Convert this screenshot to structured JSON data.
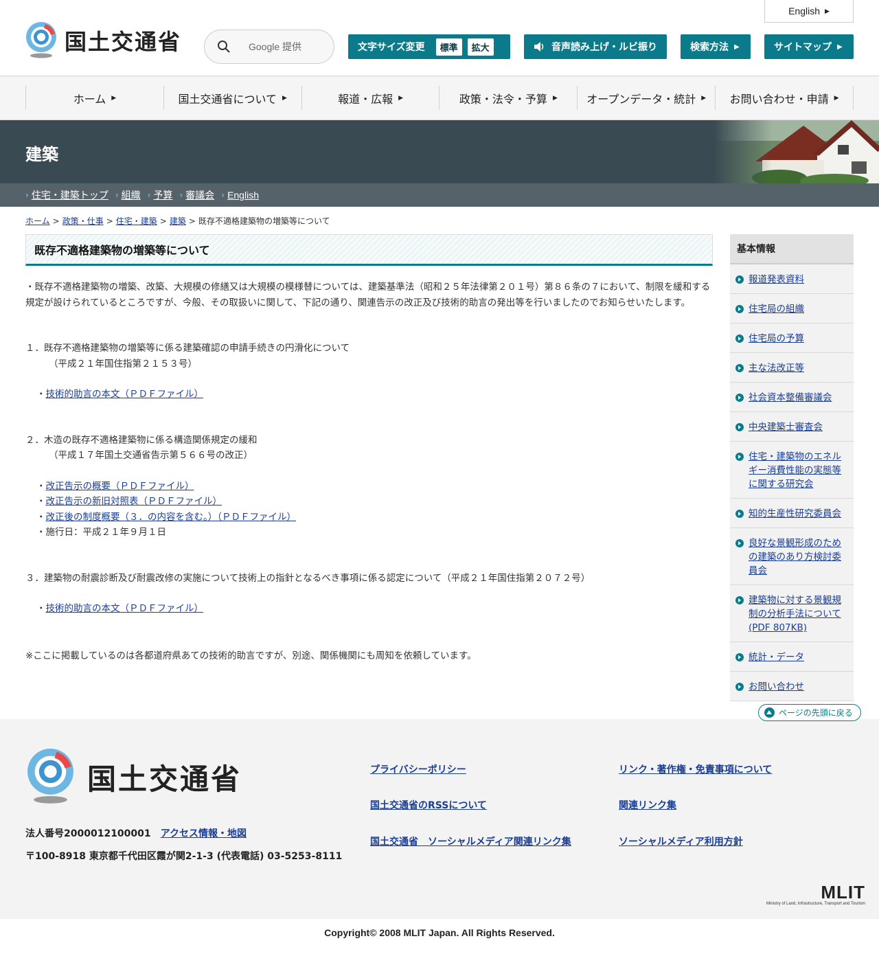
{
  "header": {
    "logo_text": "国土交通省",
    "english_label": "English",
    "search": {
      "placeholder": "Google 提供"
    },
    "fontsize": {
      "label": "文字サイズ変更",
      "standard": "標準",
      "large": "拡大"
    },
    "voice_label": "音声読み上げ・ルビ振り",
    "howsearch_label": "検索方法",
    "sitemap_label": "サイトマップ"
  },
  "gnav": [
    "ホーム",
    "国土交通省について",
    "報道・広報",
    "政策・法令・予算",
    "オープンデータ・統計",
    "お問い合わせ・申請"
  ],
  "banner": {
    "title": "建築"
  },
  "subnav": [
    "住宅・建築トップ",
    "組織",
    "予算",
    "審議会",
    "English"
  ],
  "breadcrumb": {
    "items": [
      "ホーム",
      "政策・仕事",
      "住宅・建築",
      "建築"
    ],
    "current": "既存不適格建築物の増築等について"
  },
  "main": {
    "title": "既存不適格建築物の増築等について",
    "intro": "・既存不適格建築物の増築、改築、大規模の修繕又は大規模の模様替については、建築基準法（昭和２５年法律第２０１号）第８６条の７において、制限を緩和する規定が設けられているところですが、今般、その取扱いに関して、下記の通り、関連告示の改正及び技術的助言の発出等を行いましたのでお知らせいたします。",
    "item1": {
      "head": "１．既存不適格建築物の増築等に係る建築確認の申請手続きの円滑化について",
      "sub": "（平成２１年国住指第２１５３号）",
      "link1": "技術的助言の本文（ＰＤＦファイル）"
    },
    "item2": {
      "head": "２．木造の既存不適格建築物に係る構造関係規定の緩和",
      "sub": "（平成１７年国土交通省告示第５６６号の改正）",
      "link1": "改正告示の概要（ＰＤＦファイル）",
      "link2": "改正告示の新旧対照表（ＰＤＦファイル）",
      "link3": "改正後の制度概要（３．の内容を含む。）（ＰＤＦファイル）",
      "effective": "施行日：平成２１年９月１日"
    },
    "item3": {
      "head": "３．建築物の耐震診断及び耐震改修の実施について技術上の指針となるべき事項に係る認定について（平成２１年国住指第２０７２号）",
      "link1": "技術的助言の本文（ＰＤＦファイル）"
    },
    "note": "※ここに掲載しているのは各都道府県あての技術的助言ですが、別途、関係機関にも周知を依頼しています。"
  },
  "sidebar": {
    "heading": "基本情報",
    "items": [
      "報道発表資料",
      "住宅局の組織",
      "住宅局の予算",
      "主な法改正等",
      "社会資本整備審議会",
      "中央建築士審査会",
      "住宅・建築物のエネルギー消費性能の実態等に関する研究会",
      "知的生産性研究委員会",
      "良好な景観形成のための建築のあり方検討委員会",
      "建築物に対する景観規制の分析手法について(PDF 807KB)",
      "統計・データ",
      "お問い合わせ"
    ]
  },
  "pagetop_label": "ページの先頭に戻る",
  "footer": {
    "logo_text": "国土交通省",
    "corp_number": "法人番号2000012100001",
    "access_link": "アクセス情報・地図",
    "address": "〒100-8918 東京都千代田区霞が関2-1-3 (代表電話) 03-5253-8111",
    "links": [
      "プライバシーポリシー",
      "リンク・著作権・免責事項について",
      "国土交通省のRSSについて",
      "関連リンク集",
      "国土交通省　ソーシャルメディア関連リンク集",
      "ソーシャルメディア利用方針"
    ],
    "mlit_mark": "MLIT",
    "mlit_sub": "Ministry of Land, Infrastructure, Transport and Tourism",
    "copyright": "Copyright© 2008 MLIT Japan. All Rights Reserved."
  },
  "colors": {
    "accent": "#0b7b8c",
    "banner": "#3a4a52",
    "link": "#1a3e95"
  }
}
